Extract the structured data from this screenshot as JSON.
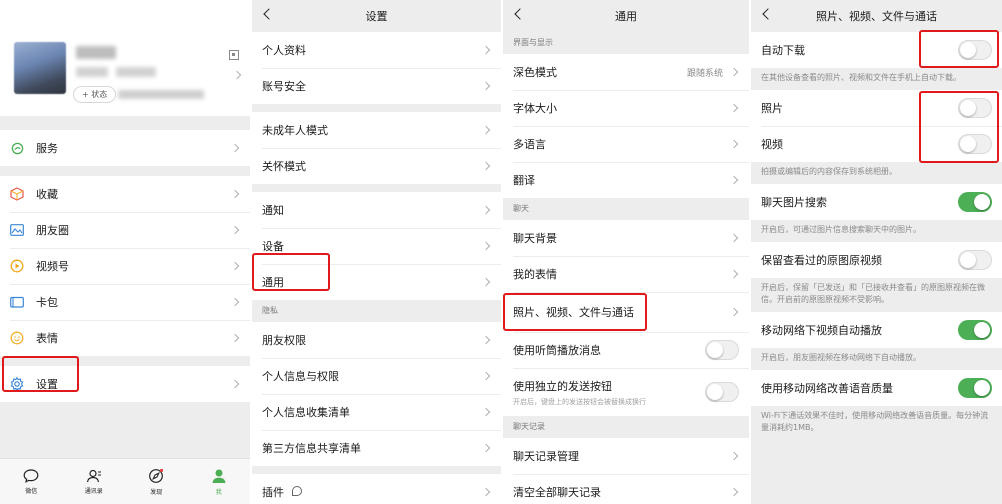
{
  "me": {
    "status_label": "+ 状态",
    "menu": [
      {
        "label": "服务",
        "icon": "service-icon"
      },
      {
        "label": "收藏",
        "icon": "favorites-icon"
      },
      {
        "label": "朋友圈",
        "icon": "moments-icon"
      },
      {
        "label": "视频号",
        "icon": "channels-icon"
      },
      {
        "label": "卡包",
        "icon": "card-wallet-icon"
      },
      {
        "label": "表情",
        "icon": "sticker-icon"
      },
      {
        "label": "设置",
        "icon": "settings-gear-icon"
      }
    ],
    "tabs": [
      {
        "label": "微信",
        "icon": "chat-icon"
      },
      {
        "label": "通讯录",
        "icon": "contacts-icon"
      },
      {
        "label": "发现",
        "icon": "compass-icon"
      },
      {
        "label": "我",
        "icon": "me-icon"
      }
    ]
  },
  "settings": {
    "title": "设置",
    "items": [
      "个人资料",
      "账号安全",
      "未成年人模式",
      "关怀模式",
      "通知",
      "设备",
      "通用",
      "朋友权限",
      "个人信息与权限",
      "个人信息收集清单",
      "第三方信息共享清单",
      "插件"
    ],
    "section_privacy": "隐私"
  },
  "general": {
    "title": "通用",
    "section_ui": "界面与显示",
    "dark_mode": "深色模式",
    "dark_mode_value": "跟随系统",
    "font_size": "字体大小",
    "language": "多语言",
    "translate": "翻译",
    "section_chat": "聊天",
    "chat_bg": "聊天背景",
    "my_stickers": "我的表情",
    "media_files": "照片、视频、文件与通话",
    "earpiece": "使用听筒播放消息",
    "send_button": "使用独立的发送按钮",
    "send_button_desc": "开启后，键盘上的发送按钮会被替换成换行",
    "section_history": "聊天记录",
    "history_manage": "聊天记录管理",
    "clear_all": "清空全部聊天记录"
  },
  "media": {
    "title": "照片、视频、文件与通话",
    "auto_download": "自动下载",
    "auto_download_desc": "在其他设备查看的照片、视频和文件在手机上自动下载。",
    "photos": "照片",
    "videos": "视频",
    "save_desc": "拍摄或编辑后的内容保存到系统相册。",
    "image_search": "聊天图片搜索",
    "image_search_desc": "开启后，可通过图片信息搜索聊天中的图片。",
    "keep_original": "保留查看过的原图原视频",
    "keep_original_desc": "开启后，保留「已发送」和「已接收并查看」的原图原视频在微信。开启前的原图原视频不受影响。",
    "autoplay": "移动网络下视频自动播放",
    "autoplay_desc": "开启后，朋友圈视频在移动网络下自动播放。",
    "voice_quality": "使用移动网络改善语音质量",
    "voice_quality_desc": "Wi-Fi下通话效果不佳时，使用移动网络改善语音质量。每分钟流量消耗约1MB。"
  },
  "colors": {
    "accent_green": "#4cae55",
    "highlight_red": "#e01a1a",
    "background": "#ededed"
  }
}
